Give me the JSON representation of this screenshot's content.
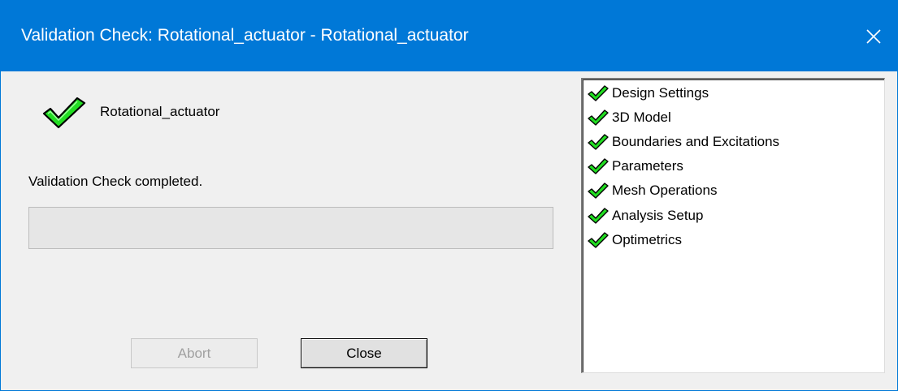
{
  "window": {
    "title": "Validation Check: Rotational_actuator - Rotational_actuator",
    "accent_color": "#0078d7"
  },
  "main": {
    "design_name": "Rotational_actuator",
    "status_text": "Validation Check completed.",
    "progress_value": 0,
    "status_icon": "green-check-icon"
  },
  "buttons": {
    "abort_label": "Abort",
    "close_label": "Close"
  },
  "checklist": {
    "items": [
      {
        "label": "Design Settings",
        "icon": "green-check-icon"
      },
      {
        "label": "3D Model",
        "icon": "green-check-icon"
      },
      {
        "label": "Boundaries and Excitations",
        "icon": "green-check-icon"
      },
      {
        "label": "Parameters",
        "icon": "green-check-icon"
      },
      {
        "label": "Mesh Operations",
        "icon": "green-check-icon"
      },
      {
        "label": "Analysis Setup",
        "icon": "green-check-icon"
      },
      {
        "label": "Optimetrics",
        "icon": "green-check-icon"
      }
    ]
  }
}
